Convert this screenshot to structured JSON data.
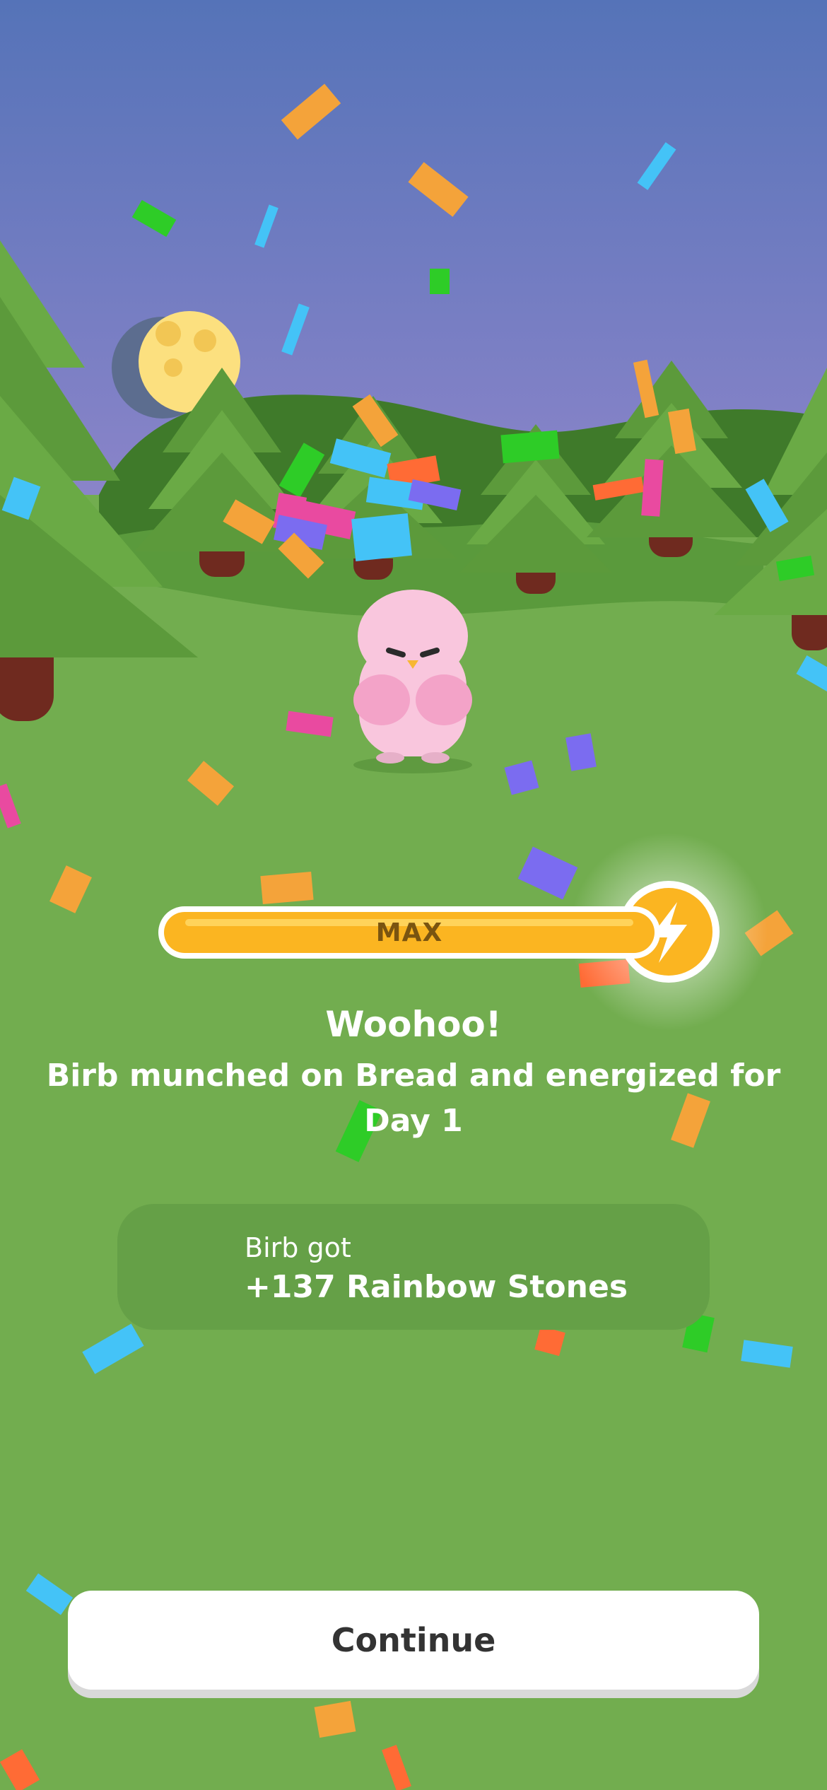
{
  "energy": {
    "label": "MAX",
    "level": 1.0
  },
  "message": {
    "title": "Woohoo!",
    "body": "Birb munched on Bread and energized for Day 1"
  },
  "reward": {
    "prefix": "Birb got",
    "amount": "+137 Rainbow Stones",
    "icon": "rainbow-stone-icon"
  },
  "actions": {
    "continue_label": "Continue"
  },
  "icons": {
    "energy": "lightning-bolt-icon"
  },
  "colors": {
    "sky_top": "#5573b8",
    "sky_bottom": "#8a84c9",
    "grass": "#72ad4f",
    "energy_fill": "#fbb521",
    "birb": "#f9c6dd"
  }
}
